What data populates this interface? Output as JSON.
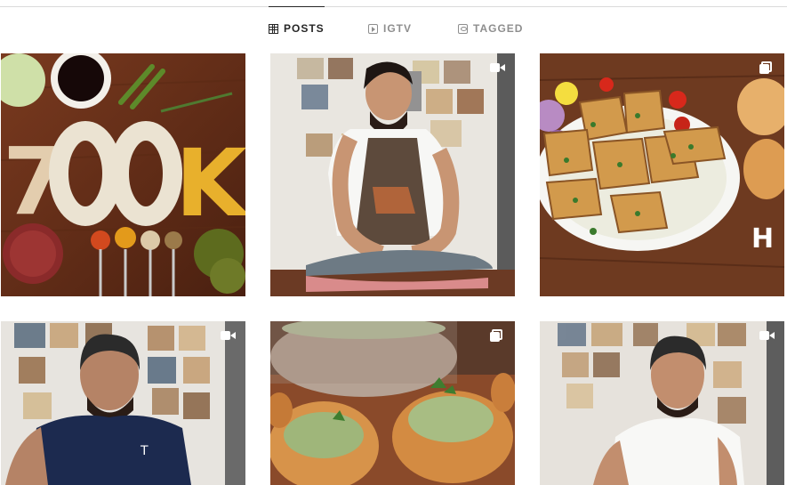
{
  "tabs": [
    {
      "label": "POSTS",
      "icon": "grid-icon",
      "active": true
    },
    {
      "label": "IGTV",
      "icon": "igtv-icon",
      "active": false
    },
    {
      "label": "TAGGED",
      "icon": "tagged-icon",
      "active": false
    }
  ],
  "posts": [
    {
      "subject": "700K made of rice and lentils with spices",
      "overlay_text": "700K",
      "type": "image"
    },
    {
      "subject": "chef slicing a whole fish",
      "type": "video"
    },
    {
      "subject": "grilled fish fillets on a plate",
      "overlay_text": "H",
      "type": "carousel"
    },
    {
      "subject": "chef in navy t-shirt",
      "shirt_text": "T",
      "type": "video"
    },
    {
      "subject": "green soup in bread bowls",
      "type": "carousel"
    },
    {
      "subject": "chef in white t-shirt",
      "type": "video"
    }
  ],
  "colors": {
    "accent": "#262626",
    "muted": "#8e8e8e",
    "divider": "#dbdbdb"
  }
}
